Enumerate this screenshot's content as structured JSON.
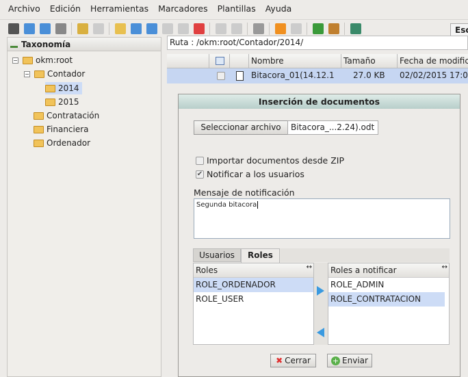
{
  "menu": [
    "Archivo",
    "Edición",
    "Herramientas",
    "Marcadores",
    "Plantillas",
    "Ayuda"
  ],
  "toolbar": {
    "icons": [
      {
        "name": "find-icon",
        "color": "#555"
      },
      {
        "name": "download-icon",
        "color": "#4a8fd8"
      },
      {
        "name": "download-pdf-icon",
        "color": "#4a8fd8"
      },
      {
        "name": "print-icon",
        "color": "#888"
      },
      "sep",
      {
        "name": "lock-icon",
        "color": "#d9b040"
      },
      {
        "name": "unlock-icon",
        "color": "#ccc"
      },
      "sep",
      {
        "name": "new-folder-icon",
        "color": "#e8c050"
      },
      {
        "name": "add-document-icon",
        "color": "#4a8fd8"
      },
      {
        "name": "edit-icon",
        "color": "#4a8fd8"
      },
      {
        "name": "checkout-icon",
        "color": "#ccc"
      },
      {
        "name": "checkin-icon",
        "color": "#ccc"
      },
      {
        "name": "delete-icon",
        "color": "#e04040"
      },
      "sep",
      {
        "name": "add-property-group-icon",
        "color": "#ccc"
      },
      {
        "name": "remove-property-group-icon",
        "color": "#ccc"
      },
      "sep",
      {
        "name": "workflow-icon",
        "color": "#999"
      },
      "sep",
      {
        "name": "add-subscription-icon",
        "color": "#f09020"
      },
      {
        "name": "remove-subscription-icon",
        "color": "#ccc"
      },
      "sep",
      {
        "name": "refresh-icon",
        "color": "#3a9a3a"
      },
      {
        "name": "home-icon",
        "color": "#c08030"
      },
      "sep",
      {
        "name": "split-view-icon",
        "color": "#3a8a6a"
      }
    ],
    "search_label": "Esc"
  },
  "sidebar": {
    "title": "Taxonomía",
    "tree": [
      {
        "label": "okm:root",
        "toggle": "−"
      },
      {
        "label": "Contador",
        "toggle": "−"
      },
      {
        "label": "2014",
        "selected": true
      },
      {
        "label": "2015"
      },
      {
        "label": "Contratación"
      },
      {
        "label": "Financiera"
      },
      {
        "label": "Ordenador"
      }
    ]
  },
  "path": "Ruta : /okm:root/Contador/2014/",
  "table": {
    "columns": [
      "Nombre",
      "Tamaño",
      "Fecha de modific"
    ],
    "rows": [
      {
        "name": "Bitacora_01(14.12.1",
        "size": "27.0 KB",
        "date": "02/02/2015 17:0"
      }
    ]
  },
  "dialog": {
    "title": "Inserción de documentos",
    "select_file": "Seleccionar archivo",
    "file_name": "Bitacora_...2.24).odt",
    "import_zip": "Importar documentos desde ZIP",
    "import_zip_checked": false,
    "notify_users": "Notificar a los usuarios",
    "notify_users_checked": true,
    "message_label": "Mensaje de notificación",
    "message": "Segunda bitacora",
    "tabs": [
      "Usuarios",
      "Roles"
    ],
    "active_tab": "Roles",
    "roles_header": "Roles",
    "roles": [
      "ROLE_ORDENADOR",
      "ROLE_USER"
    ],
    "notify_header": "Roles a notificar",
    "notify_roles": [
      "ROLE_ADMIN",
      "ROLE_CONTRATACION"
    ],
    "close": "Cerrar",
    "send": "Enviar"
  }
}
